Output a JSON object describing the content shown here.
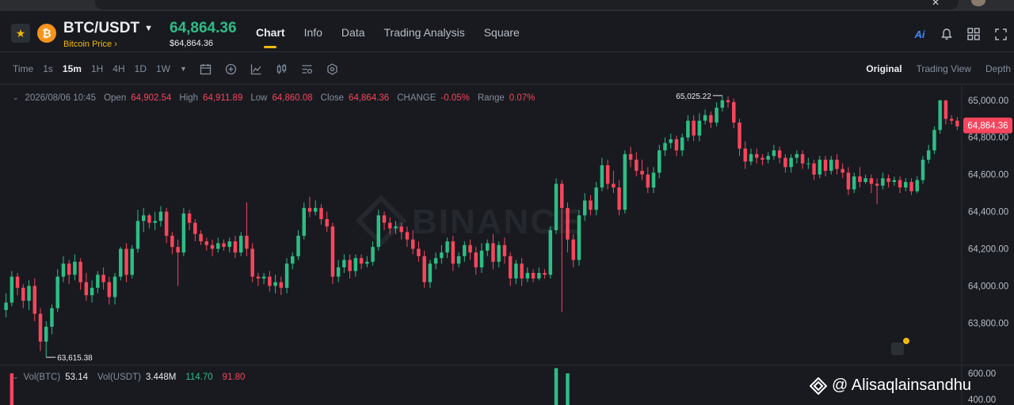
{
  "header": {
    "pair": "BTC/USDT",
    "pair_sub": "Bitcoin Price ›",
    "coin_glyph": "₿",
    "price": "64,864.36",
    "price_sub": "$64,864.36",
    "tabs": [
      "Chart",
      "Info",
      "Data",
      "Trading Analysis",
      "Square"
    ],
    "active_tab": "Chart",
    "ai_label": "Ai"
  },
  "toolbar": {
    "time_label": "Time",
    "intervals": [
      "1s",
      "15m",
      "1H",
      "4H",
      "1D",
      "1W"
    ],
    "active_interval": "15m",
    "views": [
      "Original",
      "Trading View",
      "Depth"
    ],
    "active_view": "Original"
  },
  "ohlc": {
    "date": "2026/08/06 10:45",
    "open_label": "Open",
    "open": "64,902.54",
    "high_label": "High",
    "high": "64,911.89",
    "low_label": "Low",
    "low": "64,860.08",
    "close_label": "Close",
    "close": "64,864.36",
    "change_label": "CHANGE",
    "change": "-0.05%",
    "range_label": "Range",
    "range": "0.07%"
  },
  "watermark": "BINANCE",
  "volume": {
    "btc_label": "Vol(BTC)",
    "btc": "53.14",
    "usdt_label": "Vol(USDT)",
    "usdt": "3.448M",
    "ma1": "114.70",
    "ma2": "91.80",
    "axis_ticks": [
      "600.00",
      "400.00"
    ]
  },
  "credit": "@ Alisaqlainsandhu",
  "colors": {
    "up": "#2ebd85",
    "down": "#f6465d",
    "accent": "#f0b90b",
    "bg": "#181a20"
  },
  "chart_data": {
    "type": "candlestick",
    "y_ticks": [
      65000,
      64800,
      64600,
      64400,
      64200,
      64000,
      63800
    ],
    "y_tick_labels": [
      "65,000.00",
      "64,800.00",
      "64,600.00",
      "64,400.00",
      "64,200.00",
      "64,000.00",
      "63,800.00"
    ],
    "ylim": [
      63580,
      65080
    ],
    "last_price_label": "64,864.36",
    "last_price": 64864.36,
    "max_label": "65,025.22",
    "max_value": 65025.22,
    "min_label": "63,615.38",
    "min_value": 63615.38,
    "candles": [
      [
        63870,
        63910,
        63830,
        63960
      ],
      [
        63910,
        64050,
        63890,
        64080
      ],
      [
        64050,
        63990,
        63950,
        64070
      ],
      [
        63990,
        63920,
        63880,
        64010
      ],
      [
        63920,
        64000,
        63870,
        64030
      ],
      [
        64000,
        63850,
        63810,
        64040
      ],
      [
        63850,
        63700,
        63650,
        63880
      ],
      [
        63700,
        63780,
        63615,
        63810
      ],
      [
        63780,
        63880,
        63740,
        63900
      ],
      [
        63880,
        64050,
        63860,
        64090
      ],
      [
        64050,
        64120,
        64020,
        64160
      ],
      [
        64120,
        64060,
        64010,
        64140
      ],
      [
        64060,
        64130,
        64030,
        64170
      ],
      [
        64130,
        64020,
        63980,
        64150
      ],
      [
        64020,
        63950,
        63920,
        64070
      ],
      [
        63950,
        63990,
        63910,
        64030
      ],
      [
        63990,
        64060,
        63960,
        64080
      ],
      [
        64060,
        64020,
        63980,
        64100
      ],
      [
        64020,
        63940,
        63900,
        64050
      ],
      [
        63940,
        64050,
        63900,
        64070
      ],
      [
        64050,
        64200,
        64030,
        64210
      ],
      [
        64200,
        64060,
        64020,
        64230
      ],
      [
        64060,
        64200,
        64040,
        64220
      ],
      [
        64200,
        64350,
        64180,
        64410
      ],
      [
        64350,
        64380,
        64290,
        64420
      ],
      [
        64380,
        64340,
        64310,
        64390
      ],
      [
        64340,
        64350,
        64300,
        64400
      ],
      [
        64350,
        64400,
        64320,
        64430
      ],
      [
        64400,
        64270,
        64230,
        64420
      ],
      [
        64270,
        64210,
        64170,
        64290
      ],
      [
        64210,
        64180,
        64000,
        64250
      ],
      [
        64180,
        64390,
        64160,
        64420
      ],
      [
        64390,
        64340,
        64300,
        64410
      ],
      [
        64340,
        64280,
        64240,
        64360
      ],
      [
        64280,
        64240,
        64220,
        64300
      ],
      [
        64240,
        64220,
        64190,
        64260
      ],
      [
        64220,
        64200,
        64160,
        64250
      ],
      [
        64200,
        64230,
        64180,
        64260
      ],
      [
        64230,
        64210,
        64190,
        64250
      ],
      [
        64210,
        64240,
        64180,
        64260
      ],
      [
        64240,
        64180,
        64150,
        64270
      ],
      [
        64180,
        64270,
        64160,
        64290
      ],
      [
        64270,
        64200,
        64160,
        64450
      ],
      [
        64200,
        64050,
        64020,
        64230
      ],
      [
        64050,
        64040,
        64000,
        64070
      ],
      [
        64040,
        64050,
        64010,
        64070
      ],
      [
        64050,
        64000,
        63970,
        64080
      ],
      [
        64000,
        64020,
        63960,
        64060
      ],
      [
        64020,
        63990,
        63950,
        64050
      ],
      [
        63990,
        64120,
        63960,
        64150
      ],
      [
        64120,
        64160,
        64090,
        64180
      ],
      [
        64160,
        64270,
        64140,
        64300
      ],
      [
        64270,
        64420,
        64250,
        64450
      ],
      [
        64420,
        64400,
        64370,
        64480
      ],
      [
        64400,
        64420,
        64380,
        64460
      ],
      [
        64420,
        64360,
        64330,
        64440
      ],
      [
        64360,
        64320,
        64290,
        64400
      ],
      [
        64320,
        64050,
        64010,
        64340
      ],
      [
        64050,
        64100,
        64020,
        64140
      ],
      [
        64100,
        64140,
        64070,
        64170
      ],
      [
        64140,
        64080,
        64040,
        64170
      ],
      [
        64080,
        64150,
        64050,
        64170
      ],
      [
        64150,
        64120,
        64090,
        64170
      ],
      [
        64120,
        64130,
        64100,
        64160
      ],
      [
        64130,
        64210,
        64110,
        64240
      ],
      [
        64210,
        64380,
        64190,
        64410
      ],
      [
        64380,
        64340,
        64300,
        64400
      ],
      [
        64340,
        64310,
        64280,
        64370
      ],
      [
        64310,
        64320,
        64280,
        64350
      ],
      [
        64320,
        64290,
        64250,
        64340
      ],
      [
        64290,
        64250,
        64210,
        64320
      ],
      [
        64250,
        64200,
        64170,
        64300
      ],
      [
        64200,
        64160,
        64130,
        64240
      ],
      [
        64160,
        64020,
        63990,
        64190
      ],
      [
        64020,
        64120,
        63990,
        64140
      ],
      [
        64120,
        64150,
        64090,
        64180
      ],
      [
        64150,
        64180,
        64120,
        64220
      ],
      [
        64180,
        64240,
        64150,
        64260
      ],
      [
        64240,
        64120,
        64080,
        64270
      ],
      [
        64120,
        64160,
        64100,
        64180
      ],
      [
        64160,
        64220,
        64130,
        64240
      ],
      [
        64220,
        64180,
        64140,
        64250
      ],
      [
        64180,
        64100,
        64060,
        64210
      ],
      [
        64100,
        64190,
        64070,
        64230
      ],
      [
        64190,
        64230,
        64160,
        64250
      ],
      [
        64230,
        64130,
        64090,
        64280
      ],
      [
        64130,
        64220,
        64100,
        64240
      ],
      [
        64220,
        64160,
        64120,
        64260
      ],
      [
        64160,
        64040,
        64000,
        64180
      ],
      [
        64040,
        64120,
        64010,
        64140
      ],
      [
        64120,
        64040,
        64000,
        64150
      ],
      [
        64040,
        64070,
        64020,
        64100
      ],
      [
        64070,
        64040,
        64020,
        64090
      ],
      [
        64040,
        64070,
        64030,
        64100
      ],
      [
        64070,
        64060,
        64040,
        64090
      ],
      [
        64060,
        64300,
        64040,
        64320
      ],
      [
        64300,
        64550,
        64280,
        64580
      ],
      [
        64550,
        64420,
        63860,
        64570
      ],
      [
        64420,
        64250,
        64180,
        64450
      ],
      [
        64250,
        64140,
        64100,
        64280
      ],
      [
        64140,
        64380,
        64110,
        64410
      ],
      [
        64380,
        64460,
        64350,
        64500
      ],
      [
        64460,
        64410,
        64380,
        64490
      ],
      [
        64410,
        64530,
        64380,
        64560
      ],
      [
        64530,
        64650,
        64510,
        64690
      ],
      [
        64650,
        64550,
        64520,
        64680
      ],
      [
        64550,
        64530,
        64500,
        64620
      ],
      [
        64530,
        64410,
        64380,
        64570
      ],
      [
        64410,
        64710,
        64390,
        64730
      ],
      [
        64710,
        64680,
        64640,
        64750
      ],
      [
        64680,
        64620,
        64590,
        64720
      ],
      [
        64620,
        64600,
        64570,
        64680
      ],
      [
        64600,
        64530,
        64500,
        64640
      ],
      [
        64530,
        64610,
        64500,
        64640
      ],
      [
        64610,
        64730,
        64580,
        64760
      ],
      [
        64730,
        64770,
        64700,
        64800
      ],
      [
        64770,
        64790,
        64740,
        64820
      ],
      [
        64790,
        64730,
        64700,
        64810
      ],
      [
        64730,
        64800,
        64700,
        64820
      ],
      [
        64800,
        64890,
        64780,
        64920
      ],
      [
        64890,
        64810,
        64780,
        64920
      ],
      [
        64810,
        64890,
        64780,
        64930
      ],
      [
        64890,
        64920,
        64870,
        64950
      ],
      [
        64920,
        64880,
        64850,
        64940
      ],
      [
        64880,
        64960,
        64860,
        64990
      ],
      [
        64960,
        65000,
        64940,
        65025
      ],
      [
        65000,
        64990,
        64960,
        65020
      ],
      [
        64990,
        64880,
        64850,
        65010
      ],
      [
        64880,
        64740,
        64700,
        64900
      ],
      [
        64740,
        64670,
        64630,
        64780
      ],
      [
        64670,
        64710,
        64650,
        64740
      ],
      [
        64710,
        64690,
        64660,
        64740
      ],
      [
        64690,
        64680,
        64650,
        64710
      ],
      [
        64680,
        64700,
        64660,
        64720
      ],
      [
        64700,
        64730,
        64680,
        64760
      ],
      [
        64730,
        64690,
        64660,
        64750
      ],
      [
        64690,
        64640,
        64610,
        64710
      ],
      [
        64640,
        64690,
        64610,
        64710
      ],
      [
        64690,
        64710,
        64660,
        64730
      ],
      [
        64710,
        64660,
        64630,
        64730
      ],
      [
        64660,
        64660,
        64630,
        64690
      ],
      [
        64660,
        64600,
        64570,
        64680
      ],
      [
        64600,
        64680,
        64580,
        64700
      ],
      [
        64680,
        64620,
        64590,
        64700
      ],
      [
        64620,
        64680,
        64600,
        64700
      ],
      [
        64680,
        64630,
        64600,
        64710
      ],
      [
        64630,
        64610,
        64580,
        64660
      ],
      [
        64610,
        64520,
        64490,
        64640
      ],
      [
        64520,
        64590,
        64500,
        64610
      ],
      [
        64590,
        64560,
        64530,
        64640
      ],
      [
        64560,
        64580,
        64550,
        64600
      ],
      [
        64580,
        64550,
        64500,
        64600
      ],
      [
        64550,
        64540,
        64440,
        64580
      ],
      [
        64540,
        64580,
        64520,
        64610
      ],
      [
        64580,
        64560,
        64530,
        64600
      ],
      [
        64560,
        64570,
        64540,
        64590
      ],
      [
        64570,
        64530,
        64500,
        64590
      ],
      [
        64530,
        64560,
        64510,
        64580
      ],
      [
        64560,
        64510,
        64490,
        64580
      ],
      [
        64510,
        64570,
        64500,
        64590
      ],
      [
        64570,
        64680,
        64550,
        64700
      ],
      [
        64680,
        64730,
        64660,
        64760
      ],
      [
        64730,
        64840,
        64710,
        64860
      ],
      [
        64840,
        65000,
        64820,
        65000
      ],
      [
        65000,
        64900,
        64870,
        65000
      ],
      [
        64900,
        64890,
        64870,
        64920
      ],
      [
        64890,
        64860,
        64840,
        64910
      ]
    ],
    "volume_max": 600,
    "volumes": [
      [
        520,
        0
      ],
      [
        430,
        1
      ]
    ]
  }
}
